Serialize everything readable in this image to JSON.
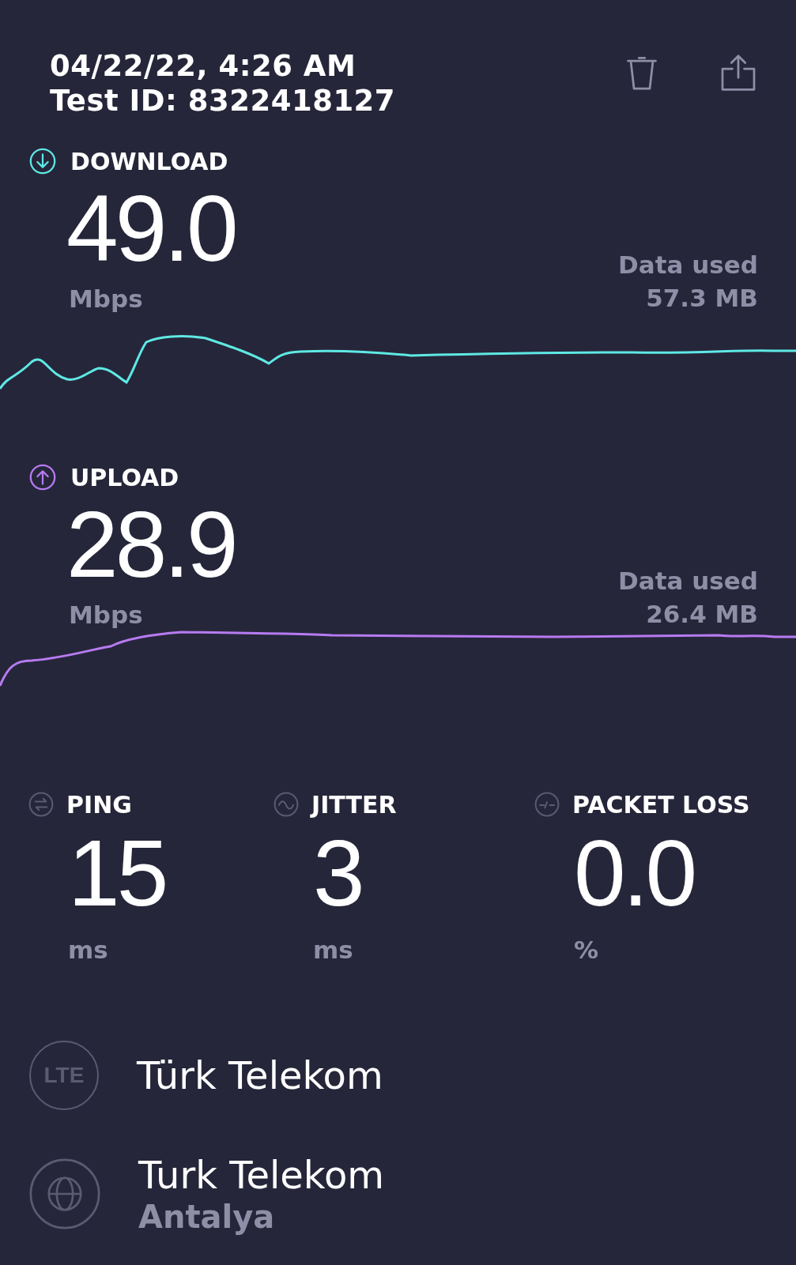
{
  "header": {
    "date": "04/22/22, 4:26 AM",
    "test_id": "Test ID: 8322418127"
  },
  "speeds": [
    {
      "kind": "download",
      "label": "DOWNLOAD",
      "value": "49.0",
      "unit": "Mbps",
      "data_label": "Data used",
      "data_value": "57.3 MB",
      "color": "#5ee9e4"
    },
    {
      "kind": "upload",
      "label": "UPLOAD",
      "value": "28.9",
      "unit": "Mbps",
      "data_label": "Data used",
      "data_value": "26.4 MB",
      "color": "#b77bf2"
    }
  ],
  "stats": [
    {
      "kind": "ping",
      "label": "PING",
      "value": "15",
      "unit": "ms"
    },
    {
      "kind": "jitter",
      "label": "JITTER",
      "value": "3",
      "unit": "ms"
    },
    {
      "kind": "packet_loss",
      "label": "PACKET LOSS",
      "value": "0.0",
      "unit": "%"
    }
  ],
  "connections": [
    {
      "kind": "lte",
      "badge": "LTE",
      "name": "Türk Telekom"
    },
    {
      "kind": "server",
      "name": "Turk Telekom",
      "location": "Antalya"
    }
  ]
}
